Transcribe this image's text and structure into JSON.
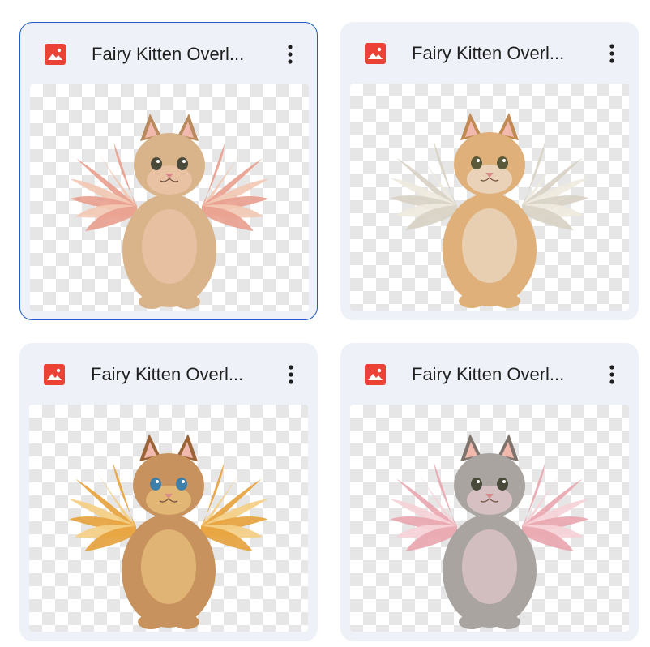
{
  "files": [
    {
      "title": "Fairy Kitten Overl...",
      "selected": true,
      "file_type_icon": "image-file-icon",
      "menu_icon": "more-vert-icon",
      "colors": {
        "wing": "#e9a08e",
        "wing_tip": "#f3c9b4",
        "fur": "#d9b48a",
        "fur_dark": "#b88a5e",
        "eye": "#4a4a3a"
      }
    },
    {
      "title": "Fairy Kitten Overl...",
      "selected": false,
      "file_type_icon": "image-file-icon",
      "menu_icon": "more-vert-icon",
      "colors": {
        "wing": "#d8d2c4",
        "wing_tip": "#efeae0",
        "fur": "#e0b07a",
        "fur_dark": "#c08a52",
        "eye": "#5a5a3a"
      }
    },
    {
      "title": "Fairy Kitten Overl...",
      "selected": false,
      "file_type_icon": "image-file-icon",
      "menu_icon": "more-vert-icon",
      "colors": {
        "wing": "#e7a33e",
        "wing_tip": "#f4cf86",
        "fur": "#c8925e",
        "fur_dark": "#9a6438",
        "eye": "#3f7fa8"
      }
    },
    {
      "title": "Fairy Kitten Overl...",
      "selected": false,
      "file_type_icon": "image-file-icon",
      "menu_icon": "more-vert-icon",
      "colors": {
        "wing": "#e9a7b0",
        "wing_tip": "#f6d3d8",
        "fur": "#a9a4a0",
        "fur_dark": "#7e746d",
        "eye": "#4a4a3a"
      }
    }
  ],
  "accent": "#1f5cc8",
  "image_icon_color": "#ea4335"
}
